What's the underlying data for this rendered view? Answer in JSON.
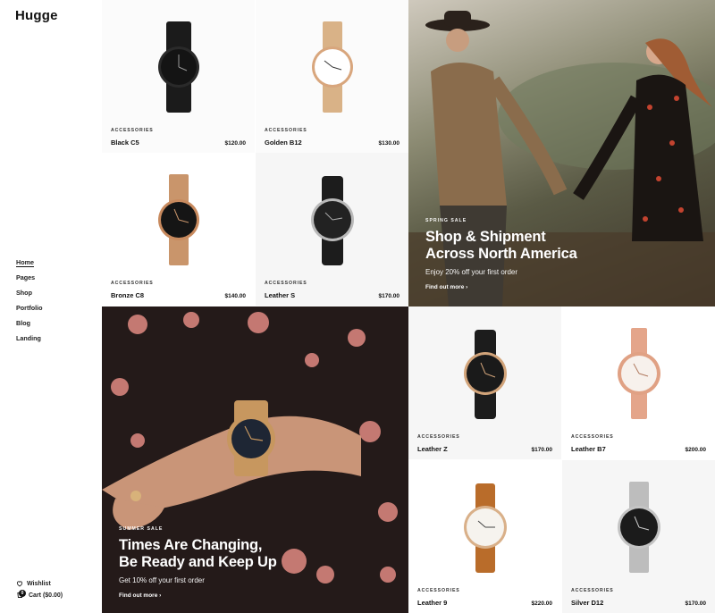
{
  "brand": {
    "logo": "Hugge"
  },
  "nav": {
    "items": [
      "Home",
      "Pages",
      "Shop",
      "Portfolio",
      "Blog",
      "Landing"
    ],
    "active": "Home"
  },
  "utility": {
    "wishlist": "Wishlist",
    "cart": "Cart ($0.00)",
    "cart_count": "0"
  },
  "products": [
    {
      "category": "ACCESSORIES",
      "name": "Black C5",
      "price": "$120.00"
    },
    {
      "category": "ACCESSORIES",
      "name": "Golden B12",
      "price": "$130.00"
    },
    {
      "category": "ACCESSORIES",
      "name": "Bronze C8",
      "price": "$140.00"
    },
    {
      "category": "ACCESSORIES",
      "name": "Leather S",
      "price": "$170.00"
    },
    {
      "category": "ACCESSORIES",
      "name": "Leather Z",
      "price": "$170.00"
    },
    {
      "category": "ACCESSORIES",
      "name": "Leather B7",
      "price": "$200.00"
    },
    {
      "category": "ACCESSORIES",
      "name": "Leather 9",
      "price": "$220.00"
    },
    {
      "category": "ACCESSORIES",
      "name": "Silver D12",
      "price": "$170.00"
    }
  ],
  "banners": {
    "spring": {
      "kicker": "SPRING SALE",
      "line1": "Shop & Shipment",
      "line2": "Across North America",
      "sub": "Enjoy 20% off your first order",
      "link": "Find out more ›"
    },
    "summer": {
      "kicker": "SUMMER SALE",
      "line1": "Times Are Changing,",
      "line2": "Be Ready and Keep Up",
      "sub": "Get 10% off your first order",
      "link": "Find out more ›"
    }
  },
  "colors": {
    "text": "#111111",
    "tile_bg": "#f6f6f6",
    "gold": "#c9956b"
  }
}
